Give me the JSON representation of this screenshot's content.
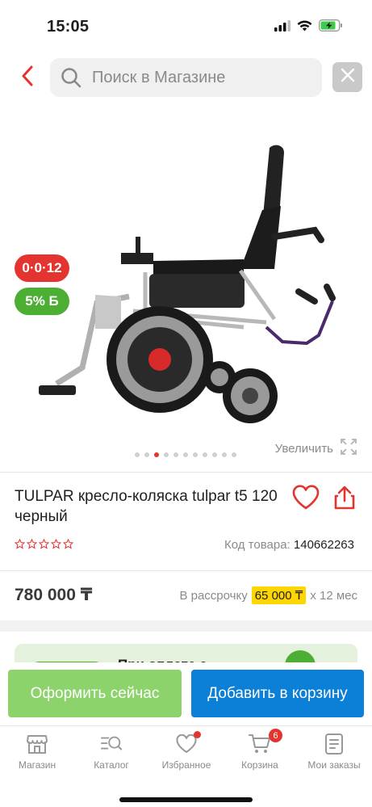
{
  "status_bar": {
    "time": "15:05"
  },
  "search": {
    "placeholder": "Поиск в Магазине"
  },
  "gallery": {
    "badge_installment": "0·0·12",
    "badge_bonus": "5% Б",
    "zoom_label": "Увеличить",
    "dots_count": 11,
    "active_dot": 2
  },
  "product": {
    "title": "TULPAR кресло-коляска tulpar t5 120 черный",
    "rating_stars": 0,
    "code_label": "Код товара:",
    "code_value": "140662263",
    "price": "780 000 ₸",
    "installment_prefix": "В рассрочку",
    "installment_amount": "65 000 ₸",
    "installment_suffix": "x 12 мес"
  },
  "promo": {
    "text": "При оплате с"
  },
  "actions": {
    "order_label": "Оформить сейчас",
    "cart_label": "Добавить в корзину"
  },
  "tabbar": {
    "items": [
      {
        "label": "Магазин"
      },
      {
        "label": "Каталог"
      },
      {
        "label": "Избранное"
      },
      {
        "label": "Корзина",
        "badge": "6"
      },
      {
        "label": "Мои заказы"
      }
    ]
  },
  "colors": {
    "accent_red": "#e3342f",
    "order_green": "#8bd36a",
    "cart_blue": "#0c7fd6",
    "bonus_green": "#4cae32",
    "installment_yellow": "#ffd600"
  }
}
